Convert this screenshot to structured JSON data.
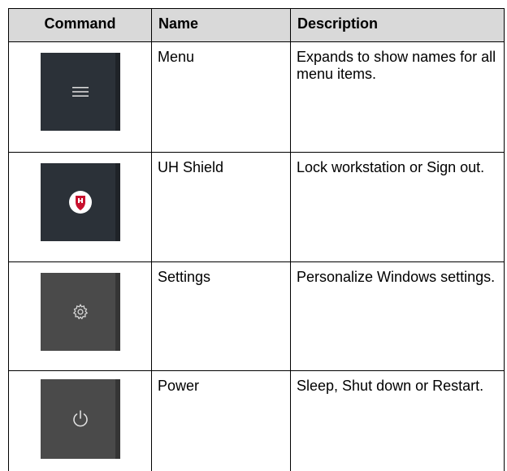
{
  "table": {
    "headers": {
      "command": "Command",
      "name": "Name",
      "description": "Description"
    },
    "rows": [
      {
        "icon": "hamburger-menu-icon",
        "name": "Menu",
        "description": "Expands to show names for all menu items."
      },
      {
        "icon": "uh-shield-icon",
        "name": "UH Shield",
        "description": "Lock workstation or Sign out."
      },
      {
        "icon": "gear-icon",
        "name": "Settings",
        "description": "Personalize Windows settings."
      },
      {
        "icon": "power-icon",
        "name": "Power",
        "description": "Sleep, Shut down or Restart."
      }
    ]
  },
  "colors": {
    "header_bg": "#d9d9d9",
    "tile_dark": "#2b3138",
    "tile_gray": "#4a4a4a",
    "shield_red": "#c8102e"
  }
}
